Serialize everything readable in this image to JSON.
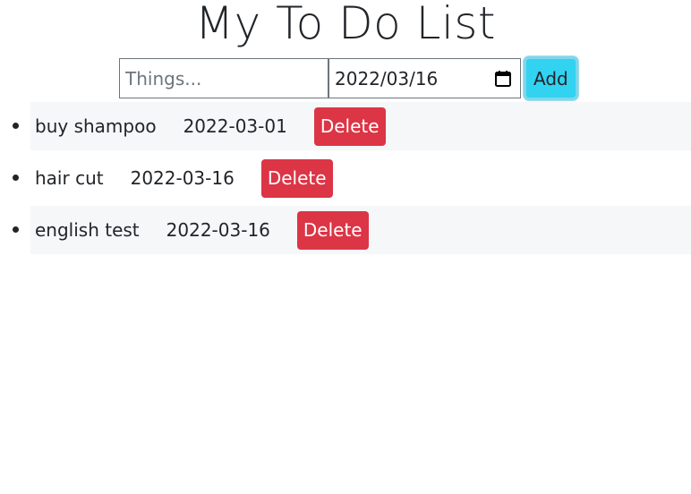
{
  "page": {
    "title": "My To Do List"
  },
  "form": {
    "text_placeholder": "Things...",
    "date_value": "2022/03/16",
    "add_label": "Add"
  },
  "todos": [
    {
      "name": "buy shampoo",
      "date": "2022-03-01",
      "delete_label": "Delete"
    },
    {
      "name": "hair cut",
      "date": "2022-03-16",
      "delete_label": "Delete"
    },
    {
      "name": "english test",
      "date": "2022-03-16",
      "delete_label": "Delete"
    }
  ],
  "icons": {
    "calendar": "calendar-icon"
  },
  "colors": {
    "add_button": "#32d2f1",
    "delete_button": "#dc3545",
    "stripe": "#f6f7f9"
  }
}
